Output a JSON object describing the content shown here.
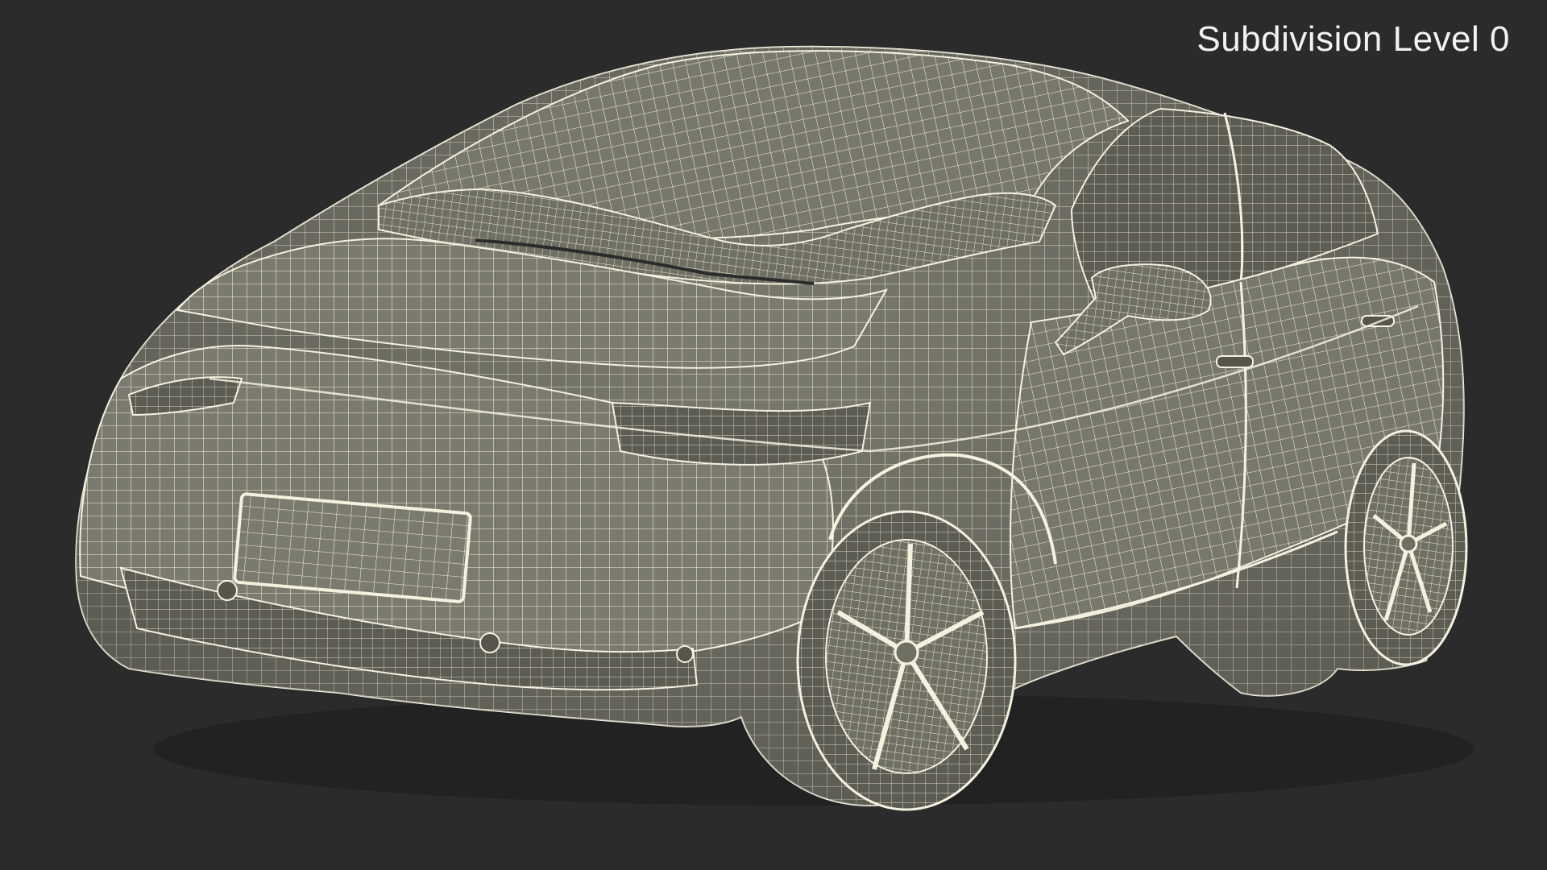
{
  "viewport": {
    "label": "Subdivision Level 0",
    "background_color": "#2b2b2b",
    "surface_color": "#7a7a6e",
    "wire_color": "#f4f1df",
    "shadow_color": "#3a3a34"
  }
}
